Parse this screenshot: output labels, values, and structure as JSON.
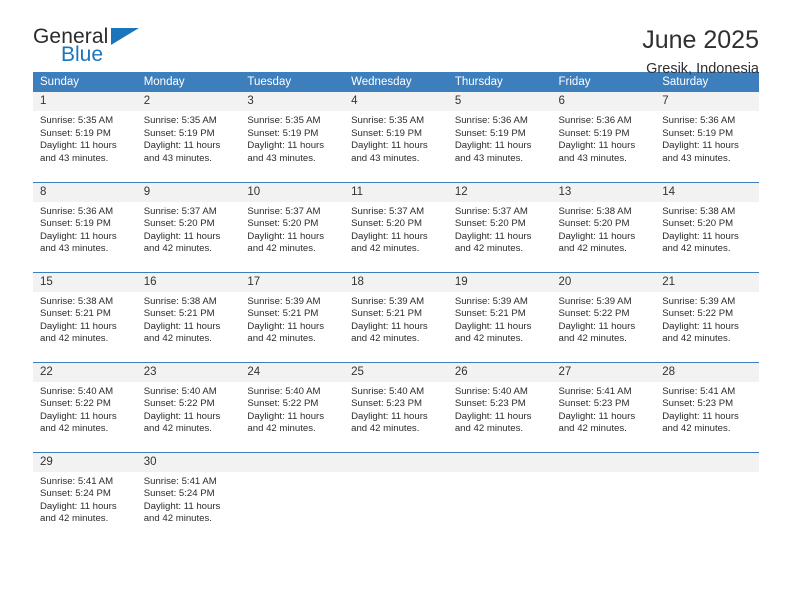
{
  "brand": {
    "name_top": "General",
    "name_bottom": "Blue",
    "accent_color": "#1b75bb"
  },
  "header": {
    "title": "June 2025",
    "subtitle": "Gresik, Indonesia"
  },
  "theme": {
    "header_bg": "#3d7ebd",
    "header_text": "#ffffff",
    "daynum_bg": "#f2f2f2",
    "row_divider": "#3d7ebd"
  },
  "weekday_headers": [
    "Sunday",
    "Monday",
    "Tuesday",
    "Wednesday",
    "Thursday",
    "Friday",
    "Saturday"
  ],
  "calendar": {
    "weeks": [
      [
        {
          "day": "1",
          "sunrise": "Sunrise: 5:35 AM",
          "sunset": "Sunset: 5:19 PM",
          "daylight_1": "Daylight: 11 hours",
          "daylight_2": "and 43 minutes."
        },
        {
          "day": "2",
          "sunrise": "Sunrise: 5:35 AM",
          "sunset": "Sunset: 5:19 PM",
          "daylight_1": "Daylight: 11 hours",
          "daylight_2": "and 43 minutes."
        },
        {
          "day": "3",
          "sunrise": "Sunrise: 5:35 AM",
          "sunset": "Sunset: 5:19 PM",
          "daylight_1": "Daylight: 11 hours",
          "daylight_2": "and 43 minutes."
        },
        {
          "day": "4",
          "sunrise": "Sunrise: 5:35 AM",
          "sunset": "Sunset: 5:19 PM",
          "daylight_1": "Daylight: 11 hours",
          "daylight_2": "and 43 minutes."
        },
        {
          "day": "5",
          "sunrise": "Sunrise: 5:36 AM",
          "sunset": "Sunset: 5:19 PM",
          "daylight_1": "Daylight: 11 hours",
          "daylight_2": "and 43 minutes."
        },
        {
          "day": "6",
          "sunrise": "Sunrise: 5:36 AM",
          "sunset": "Sunset: 5:19 PM",
          "daylight_1": "Daylight: 11 hours",
          "daylight_2": "and 43 minutes."
        },
        {
          "day": "7",
          "sunrise": "Sunrise: 5:36 AM",
          "sunset": "Sunset: 5:19 PM",
          "daylight_1": "Daylight: 11 hours",
          "daylight_2": "and 43 minutes."
        }
      ],
      [
        {
          "day": "8",
          "sunrise": "Sunrise: 5:36 AM",
          "sunset": "Sunset: 5:19 PM",
          "daylight_1": "Daylight: 11 hours",
          "daylight_2": "and 43 minutes."
        },
        {
          "day": "9",
          "sunrise": "Sunrise: 5:37 AM",
          "sunset": "Sunset: 5:20 PM",
          "daylight_1": "Daylight: 11 hours",
          "daylight_2": "and 42 minutes."
        },
        {
          "day": "10",
          "sunrise": "Sunrise: 5:37 AM",
          "sunset": "Sunset: 5:20 PM",
          "daylight_1": "Daylight: 11 hours",
          "daylight_2": "and 42 minutes."
        },
        {
          "day": "11",
          "sunrise": "Sunrise: 5:37 AM",
          "sunset": "Sunset: 5:20 PM",
          "daylight_1": "Daylight: 11 hours",
          "daylight_2": "and 42 minutes."
        },
        {
          "day": "12",
          "sunrise": "Sunrise: 5:37 AM",
          "sunset": "Sunset: 5:20 PM",
          "daylight_1": "Daylight: 11 hours",
          "daylight_2": "and 42 minutes."
        },
        {
          "day": "13",
          "sunrise": "Sunrise: 5:38 AM",
          "sunset": "Sunset: 5:20 PM",
          "daylight_1": "Daylight: 11 hours",
          "daylight_2": "and 42 minutes."
        },
        {
          "day": "14",
          "sunrise": "Sunrise: 5:38 AM",
          "sunset": "Sunset: 5:20 PM",
          "daylight_1": "Daylight: 11 hours",
          "daylight_2": "and 42 minutes."
        }
      ],
      [
        {
          "day": "15",
          "sunrise": "Sunrise: 5:38 AM",
          "sunset": "Sunset: 5:21 PM",
          "daylight_1": "Daylight: 11 hours",
          "daylight_2": "and 42 minutes."
        },
        {
          "day": "16",
          "sunrise": "Sunrise: 5:38 AM",
          "sunset": "Sunset: 5:21 PM",
          "daylight_1": "Daylight: 11 hours",
          "daylight_2": "and 42 minutes."
        },
        {
          "day": "17",
          "sunrise": "Sunrise: 5:39 AM",
          "sunset": "Sunset: 5:21 PM",
          "daylight_1": "Daylight: 11 hours",
          "daylight_2": "and 42 minutes."
        },
        {
          "day": "18",
          "sunrise": "Sunrise: 5:39 AM",
          "sunset": "Sunset: 5:21 PM",
          "daylight_1": "Daylight: 11 hours",
          "daylight_2": "and 42 minutes."
        },
        {
          "day": "19",
          "sunrise": "Sunrise: 5:39 AM",
          "sunset": "Sunset: 5:21 PM",
          "daylight_1": "Daylight: 11 hours",
          "daylight_2": "and 42 minutes."
        },
        {
          "day": "20",
          "sunrise": "Sunrise: 5:39 AM",
          "sunset": "Sunset: 5:22 PM",
          "daylight_1": "Daylight: 11 hours",
          "daylight_2": "and 42 minutes."
        },
        {
          "day": "21",
          "sunrise": "Sunrise: 5:39 AM",
          "sunset": "Sunset: 5:22 PM",
          "daylight_1": "Daylight: 11 hours",
          "daylight_2": "and 42 minutes."
        }
      ],
      [
        {
          "day": "22",
          "sunrise": "Sunrise: 5:40 AM",
          "sunset": "Sunset: 5:22 PM",
          "daylight_1": "Daylight: 11 hours",
          "daylight_2": "and 42 minutes."
        },
        {
          "day": "23",
          "sunrise": "Sunrise: 5:40 AM",
          "sunset": "Sunset: 5:22 PM",
          "daylight_1": "Daylight: 11 hours",
          "daylight_2": "and 42 minutes."
        },
        {
          "day": "24",
          "sunrise": "Sunrise: 5:40 AM",
          "sunset": "Sunset: 5:22 PM",
          "daylight_1": "Daylight: 11 hours",
          "daylight_2": "and 42 minutes."
        },
        {
          "day": "25",
          "sunrise": "Sunrise: 5:40 AM",
          "sunset": "Sunset: 5:23 PM",
          "daylight_1": "Daylight: 11 hours",
          "daylight_2": "and 42 minutes."
        },
        {
          "day": "26",
          "sunrise": "Sunrise: 5:40 AM",
          "sunset": "Sunset: 5:23 PM",
          "daylight_1": "Daylight: 11 hours",
          "daylight_2": "and 42 minutes."
        },
        {
          "day": "27",
          "sunrise": "Sunrise: 5:41 AM",
          "sunset": "Sunset: 5:23 PM",
          "daylight_1": "Daylight: 11 hours",
          "daylight_2": "and 42 minutes."
        },
        {
          "day": "28",
          "sunrise": "Sunrise: 5:41 AM",
          "sunset": "Sunset: 5:23 PM",
          "daylight_1": "Daylight: 11 hours",
          "daylight_2": "and 42 minutes."
        }
      ],
      [
        {
          "day": "29",
          "sunrise": "Sunrise: 5:41 AM",
          "sunset": "Sunset: 5:24 PM",
          "daylight_1": "Daylight: 11 hours",
          "daylight_2": "and 42 minutes."
        },
        {
          "day": "30",
          "sunrise": "Sunrise: 5:41 AM",
          "sunset": "Sunset: 5:24 PM",
          "daylight_1": "Daylight: 11 hours",
          "daylight_2": "and 42 minutes."
        },
        {
          "day": "",
          "sunrise": "",
          "sunset": "",
          "daylight_1": "",
          "daylight_2": ""
        },
        {
          "day": "",
          "sunrise": "",
          "sunset": "",
          "daylight_1": "",
          "daylight_2": ""
        },
        {
          "day": "",
          "sunrise": "",
          "sunset": "",
          "daylight_1": "",
          "daylight_2": ""
        },
        {
          "day": "",
          "sunrise": "",
          "sunset": "",
          "daylight_1": "",
          "daylight_2": ""
        },
        {
          "day": "",
          "sunrise": "",
          "sunset": "",
          "daylight_1": "",
          "daylight_2": ""
        }
      ]
    ]
  }
}
